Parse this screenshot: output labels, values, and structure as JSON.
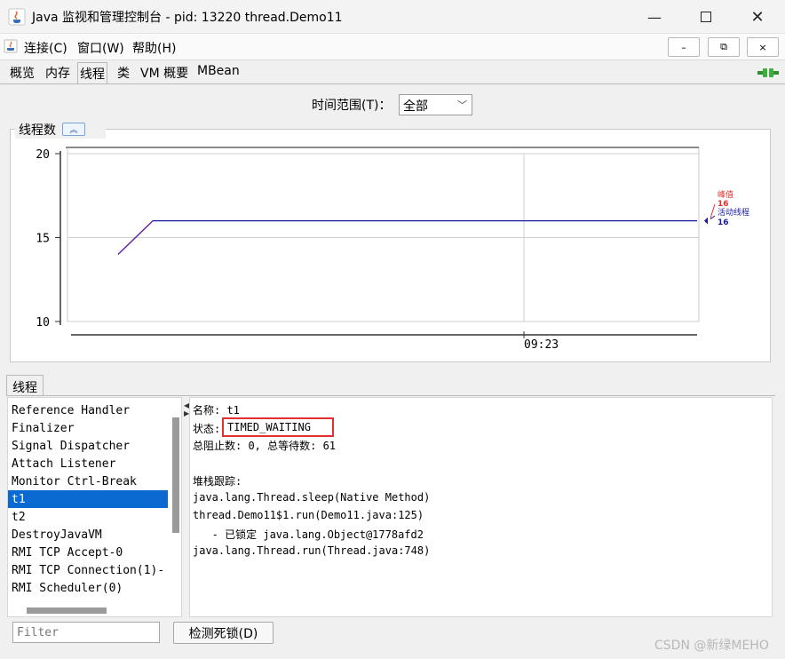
{
  "window": {
    "title": "Java 监视和管理控制台 - pid: 13220 thread.Demo11",
    "minimize_icon": "minimize-icon",
    "maximize_icon": "maximize-icon",
    "close_icon": "close-icon"
  },
  "menubar": {
    "items": [
      "连接(C)",
      "窗口(W)",
      "帮助(H)"
    ],
    "mdi_buttons": [
      "–",
      "⧉",
      "×"
    ]
  },
  "tabs": {
    "items": [
      "概览",
      "内存",
      "线程",
      "类",
      "VM 概要",
      "MBean"
    ],
    "active_index": 2
  },
  "time_range": {
    "label": "时间范围(T)：",
    "value": "全部"
  },
  "chart": {
    "panel_title": "线程数",
    "collapse_icon": "double-chevron-up-icon",
    "legend": {
      "peak_label": "峰值",
      "peak_value": "16",
      "live_label": "活动线程",
      "live_value": "16"
    },
    "colors": {
      "peak": "#e03030",
      "live": "#1a1aa0"
    }
  },
  "chart_data": {
    "type": "line",
    "title": "线程数",
    "xlabel": "",
    "ylabel": "",
    "ylim": [
      10,
      20
    ],
    "yticks": [
      10,
      15,
      20
    ],
    "xticks": [
      "09:23"
    ],
    "grid": true,
    "legend_position": "right",
    "series": [
      {
        "name": "活动线程",
        "x": [
          0,
          0.06,
          1.0
        ],
        "values": [
          14,
          16,
          16
        ]
      }
    ]
  },
  "threads": {
    "section_tab": "线程",
    "list": [
      "Reference Handler",
      "Finalizer",
      "Signal Dispatcher",
      "Attach Listener",
      "Monitor Ctrl-Break",
      "t1",
      "t2",
      "DestroyJavaVM",
      "RMI TCP Accept-0",
      "RMI TCP Connection(1)-",
      "RMI Scheduler(0)"
    ],
    "selected_index": 5,
    "detail": {
      "name_line": "名称: t1",
      "state_label": "状态:",
      "state_value": "TIMED_WAITING",
      "blocked_line": "总阻止数: 0, 总等待数: 61",
      "stack_label": "堆栈跟踪:",
      "stack": [
        "java.lang.Thread.sleep(Native Method)",
        "thread.Demo11$1.run(Demo11.java:125)",
        "   - 已锁定 java.lang.Object@1778afd2",
        "java.lang.Thread.run(Thread.java:748)"
      ]
    },
    "filter_placeholder": "Filter",
    "deadlock_button": "检测死锁(D)"
  },
  "watermark": "CSDN @新绿MEHO"
}
